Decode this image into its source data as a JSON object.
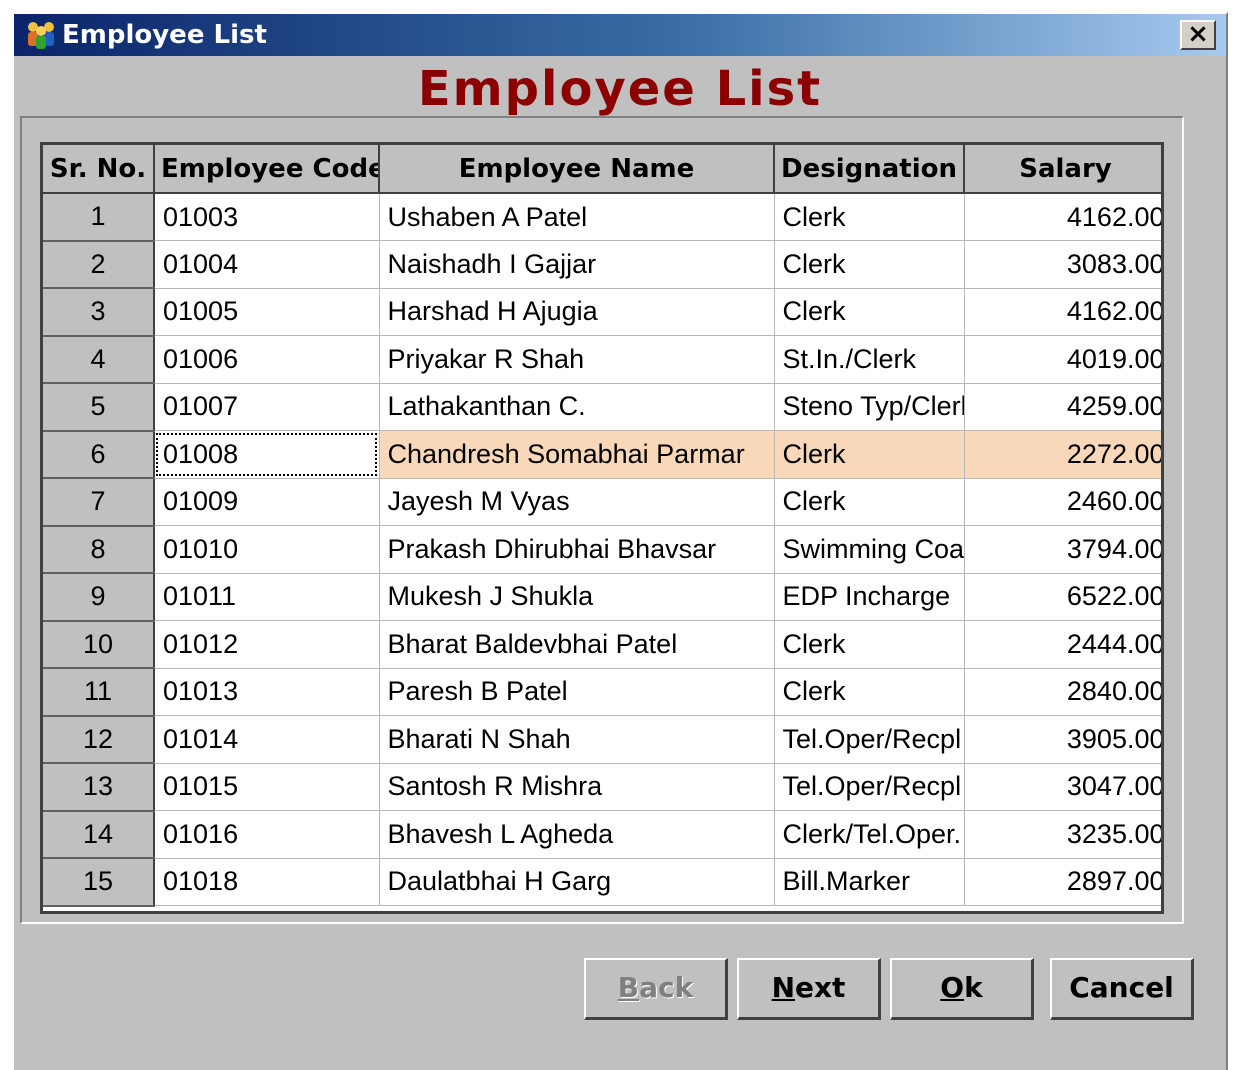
{
  "window": {
    "title": "Employee List",
    "close_label": "×",
    "icon": "people-group-icon"
  },
  "heading": "Employee List",
  "table": {
    "columns": [
      "Sr. No.",
      "Employee Code",
      "Employee Name",
      "Designation",
      "Salary"
    ],
    "selected_row": 6,
    "rows": [
      {
        "sr": "1",
        "code": "01003",
        "name": "Ushaben A Patel",
        "designation": "Clerk",
        "salary": "4162.00"
      },
      {
        "sr": "2",
        "code": "01004",
        "name": "Naishadh I Gajjar",
        "designation": "Clerk",
        "salary": "3083.00"
      },
      {
        "sr": "3",
        "code": "01005",
        "name": "Harshad H Ajugia",
        "designation": "Clerk",
        "salary": "4162.00"
      },
      {
        "sr": "4",
        "code": "01006",
        "name": "Priyakar R Shah",
        "designation": "St.In./Clerk",
        "salary": "4019.00"
      },
      {
        "sr": "5",
        "code": "01007",
        "name": "Lathakanthan C.",
        "designation": "Steno Typ/Clerl",
        "salary": "4259.00"
      },
      {
        "sr": "6",
        "code": "01008",
        "name": "Chandresh Somabhai Parmar",
        "designation": "Clerk",
        "salary": "2272.00"
      },
      {
        "sr": "7",
        "code": "01009",
        "name": "Jayesh M Vyas",
        "designation": "Clerk",
        "salary": "2460.00"
      },
      {
        "sr": "8",
        "code": "01010",
        "name": "Prakash Dhirubhai Bhavsar",
        "designation": "Swimming Coac",
        "salary": "3794.00"
      },
      {
        "sr": "9",
        "code": "01011",
        "name": "Mukesh J Shukla",
        "designation": "EDP Incharge",
        "salary": "6522.00"
      },
      {
        "sr": "10",
        "code": "01012",
        "name": "Bharat Baldevbhai Patel",
        "designation": "Clerk",
        "salary": "2444.00"
      },
      {
        "sr": "11",
        "code": "01013",
        "name": "Paresh B Patel",
        "designation": "Clerk",
        "salary": "2840.00"
      },
      {
        "sr": "12",
        "code": "01014",
        "name": "Bharati N Shah",
        "designation": "Tel.Oper/Recpl",
        "salary": "3905.00"
      },
      {
        "sr": "13",
        "code": "01015",
        "name": "Santosh R Mishra",
        "designation": "Tel.Oper/Recpl",
        "salary": "3047.00"
      },
      {
        "sr": "14",
        "code": "01016",
        "name": "Bhavesh L Agheda",
        "designation": "Clerk/Tel.Oper.",
        "salary": "3235.00"
      },
      {
        "sr": "15",
        "code": "01018",
        "name": "Daulatbhai H Garg",
        "designation": "Bill.Marker",
        "salary": "2897.00"
      }
    ]
  },
  "buttons": {
    "back": {
      "first": "B",
      "rest": "ack",
      "enabled": false
    },
    "next": {
      "first": "N",
      "rest": "ext",
      "enabled": true
    },
    "ok": {
      "first": "O",
      "rest": "k",
      "enabled": true
    },
    "cancel": {
      "label": "Cancel",
      "enabled": true
    }
  },
  "colors": {
    "heading": "#8b0000",
    "selected_row": "#f8d8b8",
    "dialog_bg": "#c0c0c0"
  }
}
